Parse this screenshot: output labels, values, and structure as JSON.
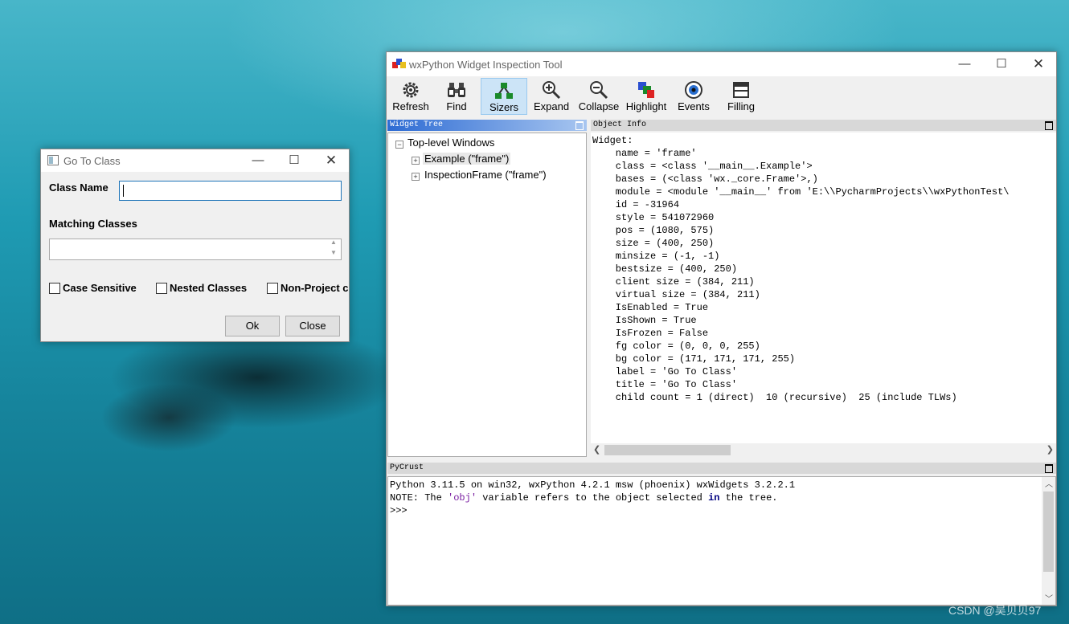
{
  "goto_dialog": {
    "title": "Go To Class",
    "class_name_label": "Class Name",
    "class_name_value": "",
    "matching_label": "Matching Classes",
    "options": [
      {
        "label": "Case Sensitive",
        "checked": false
      },
      {
        "label": "Nested Classes",
        "checked": false
      },
      {
        "label": "Non-Project c",
        "checked": false
      }
    ],
    "ok_label": "Ok",
    "close_label": "Close"
  },
  "inspector": {
    "title": "wxPython Widget Inspection Tool",
    "toolbar": [
      {
        "label": "Refresh",
        "icon": "refresh-gear-icon"
      },
      {
        "label": "Find",
        "icon": "binoculars-icon"
      },
      {
        "label": "Sizers",
        "icon": "sizers-tree-icon",
        "active": true
      },
      {
        "label": "Expand",
        "icon": "zoom-in-icon"
      },
      {
        "label": "Collapse",
        "icon": "zoom-out-icon"
      },
      {
        "label": "Highlight",
        "icon": "highlight-icon"
      },
      {
        "label": "Events",
        "icon": "events-eye-icon"
      },
      {
        "label": "Filling",
        "icon": "filling-window-icon"
      }
    ],
    "tree_header": "Widget Tree",
    "tree": {
      "root": "Top-level Windows",
      "children": [
        "Example (\"frame\")",
        "InspectionFrame (\"frame\")"
      ]
    },
    "info_header": "Object Info",
    "info_lines": [
      "Widget:",
      "    name = 'frame'",
      "    class = <class '__main__.Example'>",
      "    bases = (<class 'wx._core.Frame'>,)",
      "    module = <module '__main__' from 'E:\\\\PycharmProjects\\\\wxPythonTest\\",
      "    id = -31964",
      "    style = 541072960",
      "    pos = (1080, 575)",
      "    size = (400, 250)",
      "    minsize = (-1, -1)",
      "    bestsize = (400, 250)",
      "    client size = (384, 211)",
      "    virtual size = (384, 211)",
      "    IsEnabled = True",
      "    IsShown = True",
      "    IsFrozen = False",
      "    fg color = (0, 0, 0, 255)",
      "    bg color = (171, 171, 171, 255)",
      "    label = 'Go To Class'",
      "    title = 'Go To Class'",
      "    child count = 1 (direct)  10 (recursive)  25 (include TLWs)"
    ],
    "crust_header": "PyCrust",
    "crust_line1": "Python 3.11.5 on win32, wxPython 4.2.1 msw (phoenix) wxWidgets 3.2.2.1",
    "crust_line2_a": "NOTE: The ",
    "crust_line2_obj": "'obj'",
    "crust_line2_b": " variable refers to the object selected ",
    "crust_line2_in": "in",
    "crust_line2_c": " the tree.",
    "crust_prompt": ">>>"
  },
  "watermark": "CSDN @吴贝贝97"
}
